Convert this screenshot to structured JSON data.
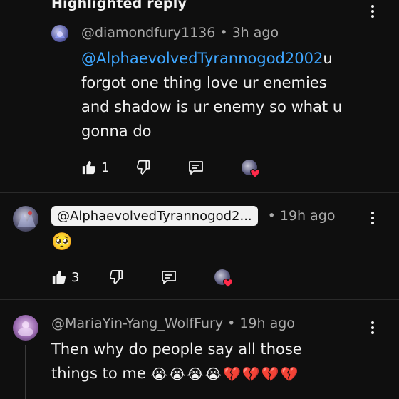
{
  "section": {
    "title": "Highlighted reply"
  },
  "comments": [
    {
      "author": "@diamondfury1136",
      "time": "3h ago",
      "mention": "@AlphaevolvedTyrannogod2002",
      "text_after_mention": "u",
      "text_lines": [
        "forgot one thing love ur enemies",
        "and shadow is ur enemy so what u",
        "gonna do"
      ],
      "likes": "1"
    },
    {
      "author_chip": "@AlphaevolvedTyrannogod2...",
      "time": "19h ago",
      "emoji": "🥺",
      "likes": "3"
    },
    {
      "author": "@MariaYin-Yang_WolfFury",
      "time": "19h ago",
      "text_line1": "Then why do people say all those",
      "text_line2": "things to me",
      "emojis": "😭😭😭😭💔💔💔💔"
    }
  ],
  "separator": "•"
}
